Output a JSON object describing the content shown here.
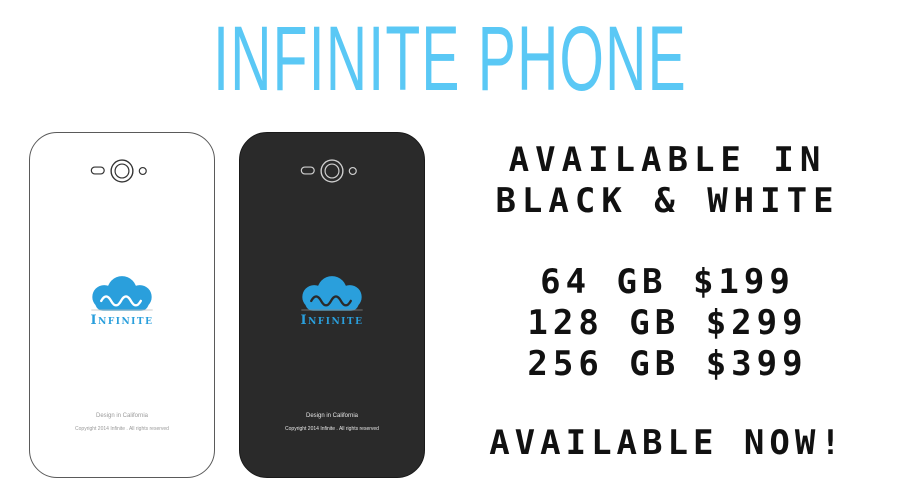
{
  "headline": "INFINITE PHONE",
  "colors": {
    "accent": "#5ac8f5",
    "logo_blue": "#2a9fdc",
    "phone_black": "#2a2a2a",
    "phone_white": "#ffffff",
    "text": "#111111"
  },
  "phones": [
    {
      "variant": "white",
      "brand": "Infinite",
      "design_text": "Design in California",
      "copyright": "Copyright 2014 Infinite . All rights reserved"
    },
    {
      "variant": "black",
      "brand": "Infinite",
      "design_text": "Design in California",
      "copyright": "Copyright 2014 Infinite . All rights reserved"
    }
  ],
  "info": {
    "availability_line1": "AVAILABLE IN",
    "availability_line2": "BLACK & WHITE",
    "prices": [
      "64 GB $199",
      "128 GB $299",
      "256 GB $399"
    ],
    "cta": "AVAILABLE NOW!"
  },
  "icons": [
    "camera-icon",
    "cloud-logo-icon"
  ]
}
